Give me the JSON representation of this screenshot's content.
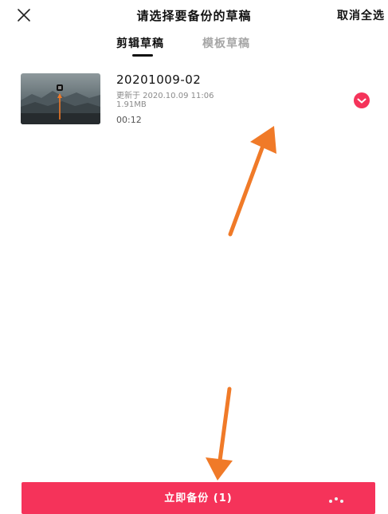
{
  "header": {
    "title": "请选择要备份的草稿",
    "deselect_all": "取消全选",
    "close_icon": "close-icon"
  },
  "tabs": [
    {
      "label": "剪辑草稿",
      "active": true
    },
    {
      "label": "模板草稿",
      "active": false
    }
  ],
  "drafts": [
    {
      "name": "20201009-02",
      "updated": "更新于 2020.10.09 11:06",
      "size": "1.91MB",
      "duration": "00:12",
      "selected": true
    }
  ],
  "footer": {
    "backup_button": "立即备份 (1)"
  },
  "colors": {
    "accent": "#f5335a",
    "annotation_arrow": "#f07a28",
    "inactive_tab": "#a6a6a6"
  }
}
